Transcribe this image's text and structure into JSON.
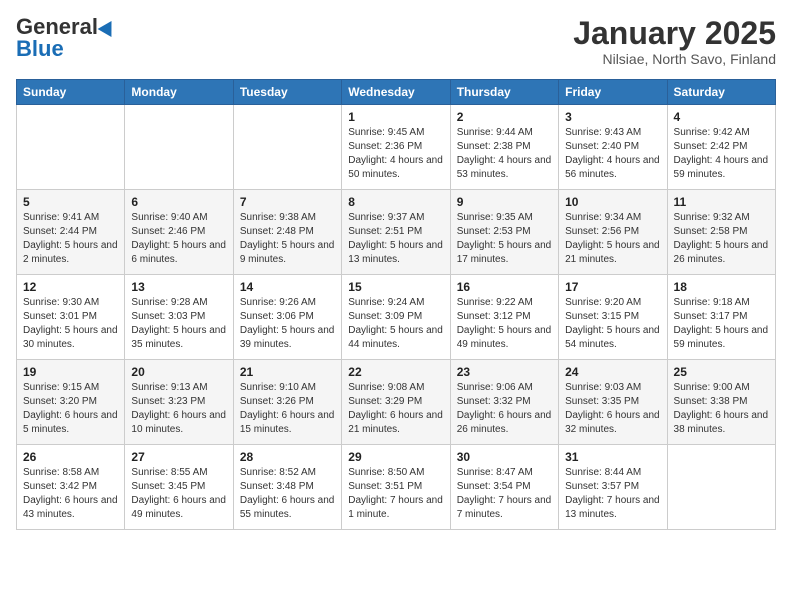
{
  "header": {
    "logo_general": "General",
    "logo_blue": "Blue",
    "title": "January 2025",
    "location": "Nilsiae, North Savo, Finland"
  },
  "days_of_week": [
    "Sunday",
    "Monday",
    "Tuesday",
    "Wednesday",
    "Thursday",
    "Friday",
    "Saturday"
  ],
  "weeks": [
    [
      {
        "day": "",
        "info": ""
      },
      {
        "day": "",
        "info": ""
      },
      {
        "day": "",
        "info": ""
      },
      {
        "day": "1",
        "info": "Sunrise: 9:45 AM\nSunset: 2:36 PM\nDaylight: 4 hours\nand 50 minutes."
      },
      {
        "day": "2",
        "info": "Sunrise: 9:44 AM\nSunset: 2:38 PM\nDaylight: 4 hours\nand 53 minutes."
      },
      {
        "day": "3",
        "info": "Sunrise: 9:43 AM\nSunset: 2:40 PM\nDaylight: 4 hours\nand 56 minutes."
      },
      {
        "day": "4",
        "info": "Sunrise: 9:42 AM\nSunset: 2:42 PM\nDaylight: 4 hours\nand 59 minutes."
      }
    ],
    [
      {
        "day": "5",
        "info": "Sunrise: 9:41 AM\nSunset: 2:44 PM\nDaylight: 5 hours\nand 2 minutes."
      },
      {
        "day": "6",
        "info": "Sunrise: 9:40 AM\nSunset: 2:46 PM\nDaylight: 5 hours\nand 6 minutes."
      },
      {
        "day": "7",
        "info": "Sunrise: 9:38 AM\nSunset: 2:48 PM\nDaylight: 5 hours\nand 9 minutes."
      },
      {
        "day": "8",
        "info": "Sunrise: 9:37 AM\nSunset: 2:51 PM\nDaylight: 5 hours\nand 13 minutes."
      },
      {
        "day": "9",
        "info": "Sunrise: 9:35 AM\nSunset: 2:53 PM\nDaylight: 5 hours\nand 17 minutes."
      },
      {
        "day": "10",
        "info": "Sunrise: 9:34 AM\nSunset: 2:56 PM\nDaylight: 5 hours\nand 21 minutes."
      },
      {
        "day": "11",
        "info": "Sunrise: 9:32 AM\nSunset: 2:58 PM\nDaylight: 5 hours\nand 26 minutes."
      }
    ],
    [
      {
        "day": "12",
        "info": "Sunrise: 9:30 AM\nSunset: 3:01 PM\nDaylight: 5 hours\nand 30 minutes."
      },
      {
        "day": "13",
        "info": "Sunrise: 9:28 AM\nSunset: 3:03 PM\nDaylight: 5 hours\nand 35 minutes."
      },
      {
        "day": "14",
        "info": "Sunrise: 9:26 AM\nSunset: 3:06 PM\nDaylight: 5 hours\nand 39 minutes."
      },
      {
        "day": "15",
        "info": "Sunrise: 9:24 AM\nSunset: 3:09 PM\nDaylight: 5 hours\nand 44 minutes."
      },
      {
        "day": "16",
        "info": "Sunrise: 9:22 AM\nSunset: 3:12 PM\nDaylight: 5 hours\nand 49 minutes."
      },
      {
        "day": "17",
        "info": "Sunrise: 9:20 AM\nSunset: 3:15 PM\nDaylight: 5 hours\nand 54 minutes."
      },
      {
        "day": "18",
        "info": "Sunrise: 9:18 AM\nSunset: 3:17 PM\nDaylight: 5 hours\nand 59 minutes."
      }
    ],
    [
      {
        "day": "19",
        "info": "Sunrise: 9:15 AM\nSunset: 3:20 PM\nDaylight: 6 hours\nand 5 minutes."
      },
      {
        "day": "20",
        "info": "Sunrise: 9:13 AM\nSunset: 3:23 PM\nDaylight: 6 hours\nand 10 minutes."
      },
      {
        "day": "21",
        "info": "Sunrise: 9:10 AM\nSunset: 3:26 PM\nDaylight: 6 hours\nand 15 minutes."
      },
      {
        "day": "22",
        "info": "Sunrise: 9:08 AM\nSunset: 3:29 PM\nDaylight: 6 hours\nand 21 minutes."
      },
      {
        "day": "23",
        "info": "Sunrise: 9:06 AM\nSunset: 3:32 PM\nDaylight: 6 hours\nand 26 minutes."
      },
      {
        "day": "24",
        "info": "Sunrise: 9:03 AM\nSunset: 3:35 PM\nDaylight: 6 hours\nand 32 minutes."
      },
      {
        "day": "25",
        "info": "Sunrise: 9:00 AM\nSunset: 3:38 PM\nDaylight: 6 hours\nand 38 minutes."
      }
    ],
    [
      {
        "day": "26",
        "info": "Sunrise: 8:58 AM\nSunset: 3:42 PM\nDaylight: 6 hours\nand 43 minutes."
      },
      {
        "day": "27",
        "info": "Sunrise: 8:55 AM\nSunset: 3:45 PM\nDaylight: 6 hours\nand 49 minutes."
      },
      {
        "day": "28",
        "info": "Sunrise: 8:52 AM\nSunset: 3:48 PM\nDaylight: 6 hours\nand 55 minutes."
      },
      {
        "day": "29",
        "info": "Sunrise: 8:50 AM\nSunset: 3:51 PM\nDaylight: 7 hours\nand 1 minute."
      },
      {
        "day": "30",
        "info": "Sunrise: 8:47 AM\nSunset: 3:54 PM\nDaylight: 7 hours\nand 7 minutes."
      },
      {
        "day": "31",
        "info": "Sunrise: 8:44 AM\nSunset: 3:57 PM\nDaylight: 7 hours\nand 13 minutes."
      },
      {
        "day": "",
        "info": ""
      }
    ]
  ]
}
